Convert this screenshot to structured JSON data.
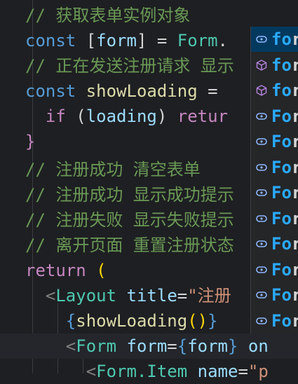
{
  "editor": {
    "lines": [
      {
        "parts": [
          {
            "c": "t-comment",
            "t": "// 获取表单实例对象"
          }
        ]
      },
      {
        "parts": [
          {
            "c": "t-kw",
            "t": "const "
          },
          {
            "c": "t-punc",
            "t": "["
          },
          {
            "c": "t-var",
            "t": "form"
          },
          {
            "c": "t-punc",
            "t": "] = "
          },
          {
            "c": "t-type",
            "t": "Form"
          },
          {
            "c": "t-punc",
            "t": "."
          }
        ]
      },
      {
        "parts": [
          {
            "c": "t-comment",
            "t": "// 正在发送注册请求 显示"
          }
        ]
      },
      {
        "parts": [
          {
            "c": "t-kw",
            "t": "const "
          },
          {
            "c": "t-func",
            "t": "showLoading"
          },
          {
            "c": "t-punc",
            "t": " ="
          }
        ]
      },
      {
        "parts": [
          {
            "c": "t-ctrl",
            "t": "  if "
          },
          {
            "c": "t-punc",
            "t": "("
          },
          {
            "c": "t-var",
            "t": "loading"
          },
          {
            "c": "t-punc",
            "t": ") "
          },
          {
            "c": "t-ctrl",
            "t": "retur"
          }
        ]
      },
      {
        "parts": [
          {
            "c": "t-brace",
            "t": "}"
          }
        ]
      },
      {
        "parts": [
          {
            "c": "t-comment",
            "t": "// 注册成功 清空表单"
          }
        ]
      },
      {
        "parts": [
          {
            "c": "t-comment",
            "t": "// 注册成功 显示成功提示"
          }
        ]
      },
      {
        "parts": [
          {
            "c": "t-comment",
            "t": "// 注册失败 显示失败提示"
          }
        ]
      },
      {
        "parts": [
          {
            "c": "t-comment",
            "t": "// 离开页面 重置注册状态"
          }
        ]
      },
      {
        "parts": [
          {
            "c": "t-ctrl",
            "t": "return "
          },
          {
            "c": "t-brace2",
            "t": "("
          }
        ]
      },
      {
        "parts": [
          {
            "c": "t-tag",
            "t": "  <"
          },
          {
            "c": "t-type",
            "t": "Layout "
          },
          {
            "c": "t-attr",
            "t": "title"
          },
          {
            "c": "t-punc",
            "t": "="
          },
          {
            "c": "t-str",
            "t": "\"注册"
          }
        ]
      },
      {
        "parts": [
          {
            "c": "t-kw",
            "t": "    {"
          },
          {
            "c": "t-func",
            "t": "showLoading"
          },
          {
            "c": "t-brace2",
            "t": "()"
          },
          {
            "c": "t-kw",
            "t": "}"
          }
        ]
      },
      {
        "parts": [
          {
            "c": "t-tag",
            "t": "    <"
          },
          {
            "c": "t-type",
            "t": "Form "
          },
          {
            "c": "t-attr",
            "t": "form"
          },
          {
            "c": "t-punc",
            "t": "="
          },
          {
            "c": "t-kw",
            "t": "{"
          },
          {
            "c": "t-var",
            "t": "form"
          },
          {
            "c": "t-kw",
            "t": "}"
          },
          {
            "c": "t-attr",
            "t": " on"
          }
        ]
      },
      {
        "parts": [
          {
            "c": "t-tag",
            "t": "      <"
          },
          {
            "c": "t-type",
            "t": "Form.Item "
          },
          {
            "c": "t-attr",
            "t": "name"
          },
          {
            "c": "t-punc",
            "t": "="
          },
          {
            "c": "t-str",
            "t": "\"p"
          }
        ]
      }
    ]
  },
  "suggest": {
    "items": [
      {
        "icon": "module-icon",
        "match": "fo",
        "rest": "r"
      },
      {
        "icon": "cube-icon",
        "match": "fo",
        "rest": "r"
      },
      {
        "icon": "cube-icon",
        "match": "fo",
        "rest": "r"
      },
      {
        "icon": "module-icon",
        "match": "Fo",
        "rest": "r"
      },
      {
        "icon": "module-icon",
        "match": "Fo",
        "rest": "r"
      },
      {
        "icon": "module-icon",
        "match": "Fo",
        "rest": "r"
      },
      {
        "icon": "module-icon",
        "match": "Fo",
        "rest": "r"
      },
      {
        "icon": "module-icon",
        "match": "Fo",
        "rest": "r"
      },
      {
        "icon": "module-icon",
        "match": "Fo",
        "rest": "r"
      },
      {
        "icon": "module-icon",
        "match": "Fo",
        "rest": "r"
      },
      {
        "icon": "module-icon",
        "match": "Fo",
        "rest": "r"
      },
      {
        "icon": "module-icon",
        "match": "Fo",
        "rest": "r"
      }
    ]
  },
  "colors": {
    "accent": "#2aaaff",
    "selection": "#04395e",
    "background": "#1e1f22"
  }
}
